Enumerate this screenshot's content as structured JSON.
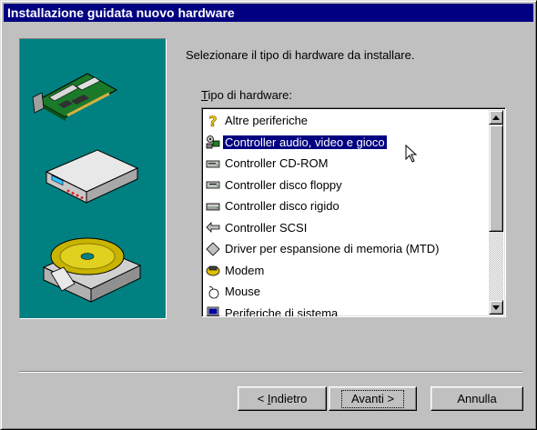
{
  "window": {
    "title": "Installazione guidata nuovo hardware"
  },
  "wizard": {
    "instruction": "Selezionare il tipo di hardware da installare.",
    "list_label_accel": "T",
    "list_label_rest": "ipo di hardware:",
    "selected_index": 1,
    "items": [
      {
        "label": "Altre periferiche",
        "icon": "question-mark-icon"
      },
      {
        "label": "Controller audio, video e gioco",
        "icon": "audio-video-icon"
      },
      {
        "label": "Controller CD-ROM",
        "icon": "cdrom-drive-icon"
      },
      {
        "label": "Controller disco floppy",
        "icon": "floppy-drive-icon"
      },
      {
        "label": "Controller disco rigido",
        "icon": "hard-disk-icon"
      },
      {
        "label": "Controller SCSI",
        "icon": "scsi-icon"
      },
      {
        "label": "Driver per espansione di memoria (MTD)",
        "icon": "memory-card-icon"
      },
      {
        "label": "Modem",
        "icon": "modem-icon"
      },
      {
        "label": "Mouse",
        "icon": "mouse-icon"
      },
      {
        "label": "Periferiche di sistema",
        "icon": "computer-icon"
      }
    ]
  },
  "buttons": {
    "back_prefix": "< ",
    "back_accel": "I",
    "back_rest": "ndietro",
    "next": "Avanti >",
    "cancel": "Annulla"
  },
  "colors": {
    "title_bar": "#000080",
    "selection": "#000080",
    "art_background": "#008080",
    "face": "#c0c0c0"
  }
}
